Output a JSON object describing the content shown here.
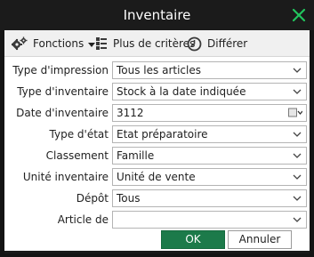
{
  "window": {
    "title": "Inventaire"
  },
  "toolbar": {
    "functions_label": "Fonctions",
    "more_criteria_label": "Plus de critères",
    "defer_label": "Différer"
  },
  "form": {
    "rows": [
      {
        "label": "Type d'impression",
        "value": "Tous les articles"
      },
      {
        "label": "Type d'inventaire",
        "value": "Stock à la date indiquée"
      },
      {
        "label": "Date d'inventaire",
        "value": "3112"
      },
      {
        "label": "Type d'état",
        "value": "Etat préparatoire"
      },
      {
        "label": "Classement",
        "value": "Famille"
      },
      {
        "label": "Unité inventaire",
        "value": "Unité de vente"
      },
      {
        "label": "Dépôt",
        "value": "Tous"
      },
      {
        "label": "Article de",
        "value": ""
      }
    ]
  },
  "buttons": {
    "ok_label": "OK",
    "cancel_label": "Annuler"
  },
  "colors": {
    "accent": "#1c7a4a",
    "title_bar": "#1b1b1b",
    "close_icon": "#22c55e"
  },
  "icons": {
    "close": "close-icon",
    "functions": "gears-icon",
    "more_criteria": "criteria-icon",
    "defer": "clock-icon",
    "dropdown": "chevron-down-icon",
    "date": "calendar-icon"
  }
}
